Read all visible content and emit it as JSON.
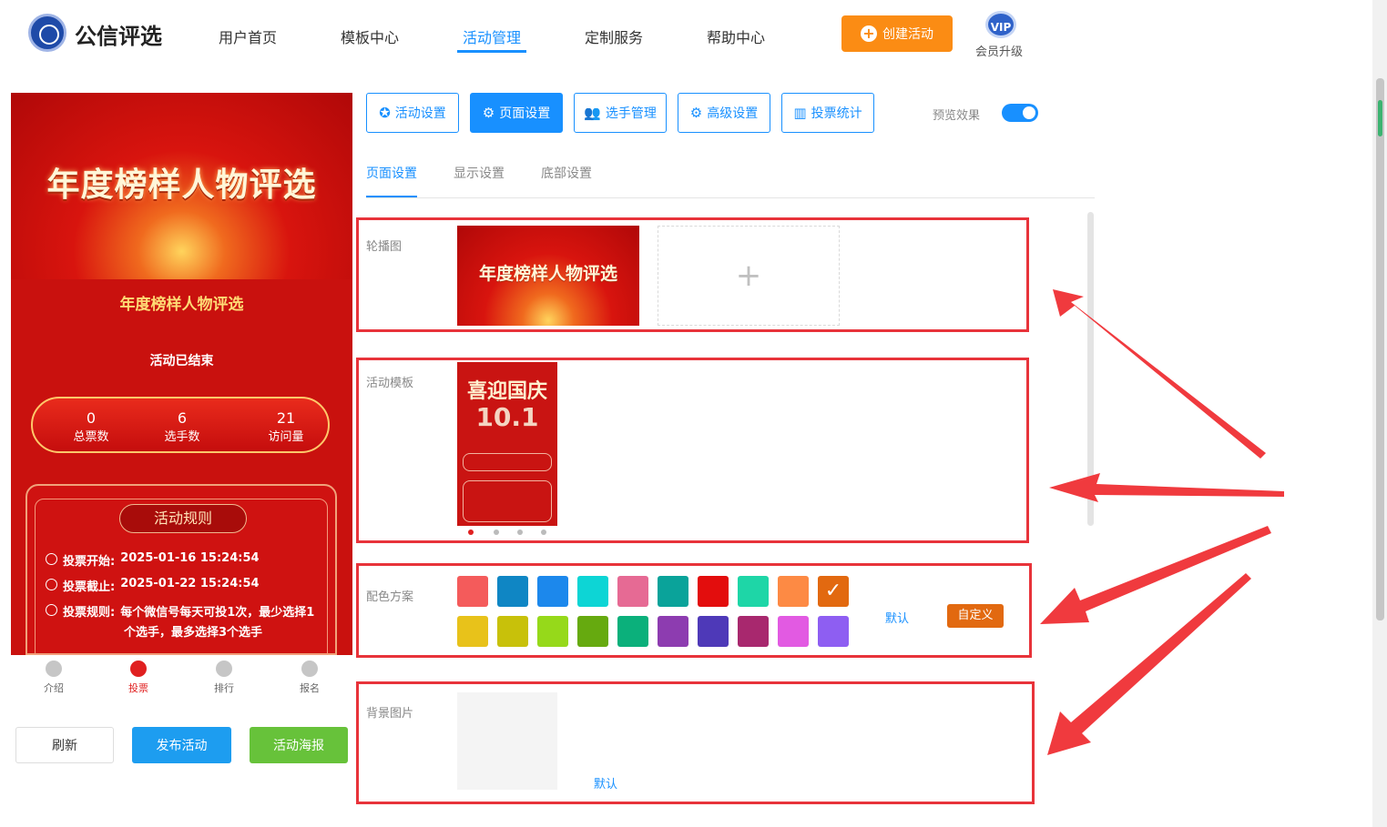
{
  "header": {
    "logo_text": "公信评选",
    "nav": [
      "用户首页",
      "模板中心",
      "活动管理",
      "定制服务",
      "帮助中心"
    ],
    "active_nav": "活动管理",
    "create_button": "创建活动",
    "vip_badge": "VIP",
    "vip_label": "会员升级"
  },
  "preview": {
    "banner_title": "年度榜样人物评选",
    "subtitle": "年度榜样人物评选",
    "status": "活动已结束",
    "stats": [
      {
        "value": "0",
        "label": "总票数"
      },
      {
        "value": "6",
        "label": "选手数"
      },
      {
        "value": "21",
        "label": "访问量"
      }
    ],
    "rules_title": "活动规则",
    "rules": [
      {
        "label": "投票开始:",
        "value": "2025-01-16 15:24:54"
      },
      {
        "label": "投票截止:",
        "value": "2025-01-22 15:24:54"
      },
      {
        "label": "投票规则:",
        "value": "每个微信号每天可投1次，最少选择1",
        "value2": "个选手，最多选择3个选手"
      }
    ],
    "tabs": [
      "介绍",
      "投票",
      "排行",
      "报名"
    ],
    "active_tab": "投票"
  },
  "actions": {
    "refresh": "刷新",
    "publish": "发布活动",
    "poster": "活动海报"
  },
  "toolbar": {
    "tabs": [
      "活动设置",
      "页面设置",
      "选手管理",
      "高级设置",
      "投票统计"
    ],
    "active": "页面设置",
    "preview_label": "预览效果",
    "preview_on": true
  },
  "sub_tabs": [
    "页面设置",
    "显示设置",
    "底部设置"
  ],
  "active_sub_tab": "页面设置",
  "sections": {
    "carousel_label": "轮播图",
    "carousel_image_text": "年度榜样人物评选",
    "carousel_add": "+",
    "template_label": "活动模板",
    "template_thumb_title": "喜迎国庆",
    "template_thumb_big": "10.1",
    "color_label": "配色方案",
    "color_default": "默认",
    "color_custom": "自定义",
    "bg_label": "背景图片",
    "bg_default": "默认"
  },
  "color_swatches": {
    "row1": [
      "#f45b5b",
      "#0f86c4",
      "#1c88ec",
      "#0dd5d5",
      "#e66a94",
      "#0aa39a",
      "#e30d0d",
      "#1ed6a7",
      "#fd8a44",
      "#e26910"
    ],
    "row2": [
      "#e8c21a",
      "#c8c10a",
      "#96d91a",
      "#66aa0f",
      "#0bb07b",
      "#8d3cb0",
      "#4e39b8",
      "#a8286e",
      "#e25ae2",
      "#8e5ef2"
    ],
    "selected": "#e26910"
  },
  "colors": {
    "accent": "#1890ff",
    "highlight_box": "#e8333a",
    "create_button": "#fb8c14",
    "publish": "#1d9df0",
    "poster": "#67c23a"
  }
}
